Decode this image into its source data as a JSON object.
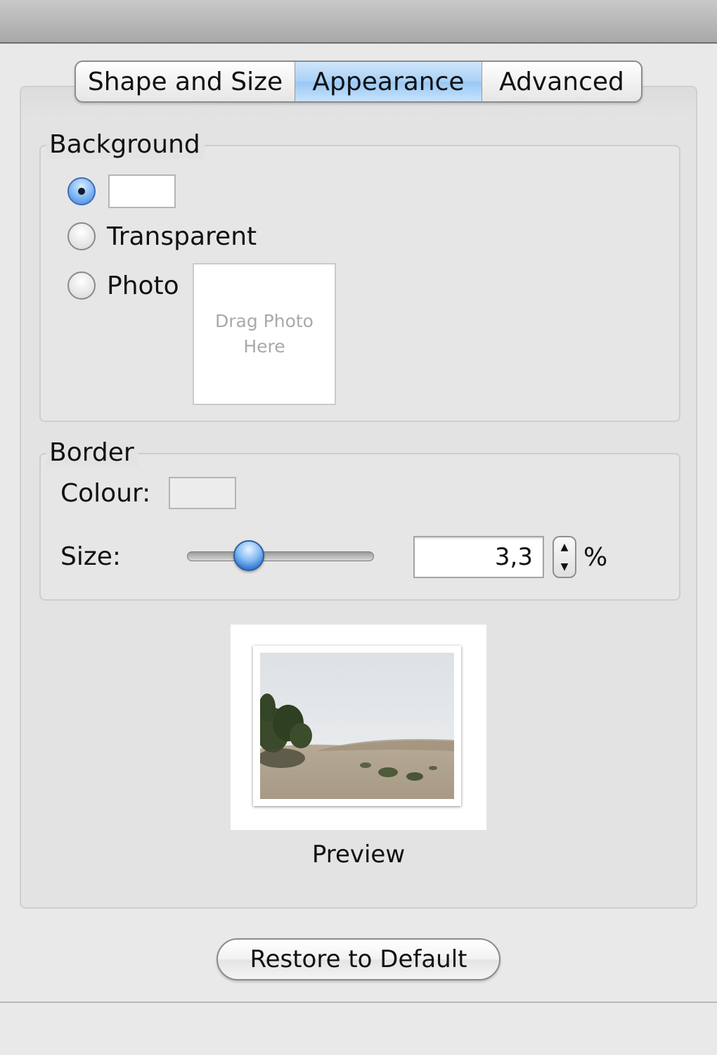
{
  "tabs": [
    {
      "label": "Shape and Size",
      "selected": false
    },
    {
      "label": "Appearance",
      "selected": true
    },
    {
      "label": "Advanced",
      "selected": false
    }
  ],
  "background": {
    "title": "Background",
    "options": [
      {
        "label": "",
        "selected": true,
        "swatch_color": "#ffffff"
      },
      {
        "label": "Transparent",
        "selected": false
      },
      {
        "label": "Photo",
        "selected": false
      }
    ],
    "dropzone_text": "Drag Photo Here"
  },
  "border": {
    "title": "Border",
    "colour_label": "Colour:",
    "colour_value": "#ececec",
    "size_label": "Size:",
    "size_slider_fraction": 0.33,
    "size_value": "3,3",
    "size_unit": "%"
  },
  "preview": {
    "label": "Preview"
  },
  "restore_button_label": "Restore to Default",
  "colors": {
    "accent": "#3f83db",
    "tab_selected": "#a9d0f6"
  }
}
